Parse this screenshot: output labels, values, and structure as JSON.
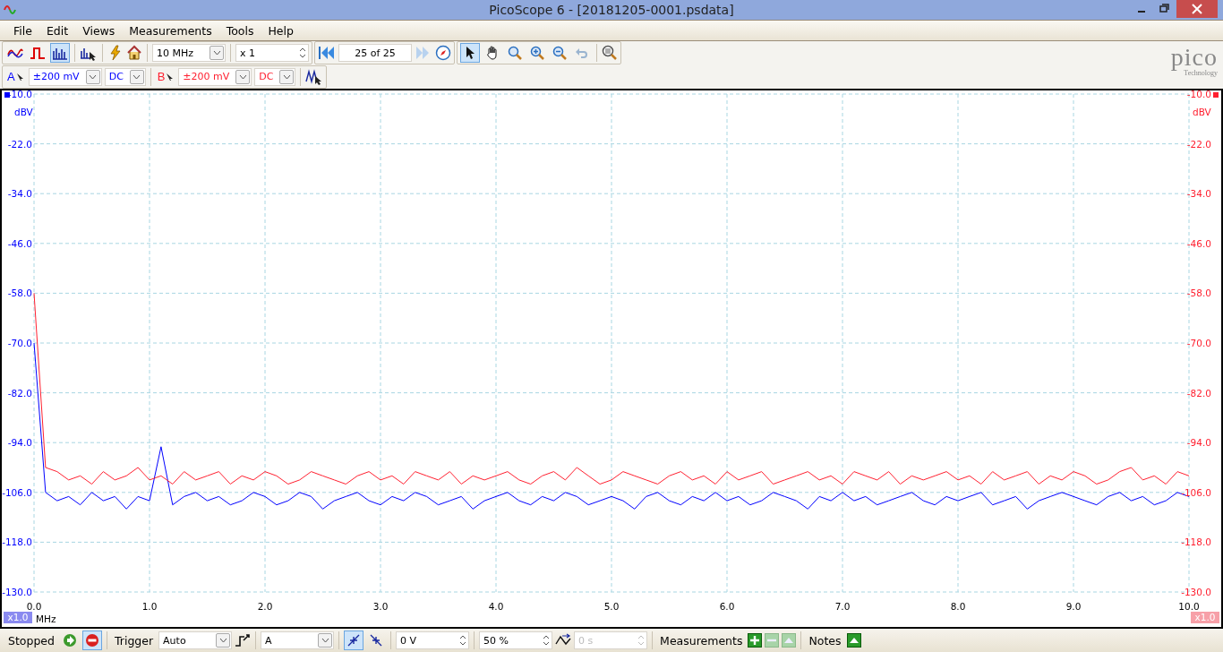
{
  "window": {
    "title": "PicoScope 6 - [20181205-0001.psdata]"
  },
  "menu": [
    "File",
    "Edit",
    "Views",
    "Measurements",
    "Tools",
    "Help"
  ],
  "toolbar": {
    "modes": [
      {
        "kind": "scope",
        "selected": false
      },
      {
        "kind": "persist",
        "selected": false
      },
      {
        "kind": "spectrum",
        "selected": true
      }
    ],
    "timebase": "10 MHz",
    "zoom": "x 1",
    "buffer": "25 of 25",
    "tools": [
      {
        "kind": "pointer",
        "selected": true
      },
      {
        "kind": "hand",
        "selected": false
      },
      {
        "kind": "zoom",
        "selected": false
      },
      {
        "kind": "zoom-in",
        "selected": false
      },
      {
        "kind": "zoom-out",
        "selected": false
      },
      {
        "kind": "undo",
        "selected": false
      }
    ]
  },
  "channels": [
    {
      "name": "A",
      "range": "±200 mV",
      "coupling": "DC",
      "color": "#0000ff"
    },
    {
      "name": "B",
      "range": "±200 mV",
      "coupling": "DC",
      "color": "#ff2030"
    }
  ],
  "logo": {
    "name": "pico",
    "tagline": "Technology"
  },
  "plot": {
    "right_ylabel": "dBV",
    "right_yticks": [
      "-10.0",
      "-22.0",
      "-34.0",
      "-46.0",
      "-58.0",
      "-70.0",
      "-82.0",
      "-94.0",
      "-106.0",
      "-118.0",
      "-130.0"
    ],
    "scale_left": "x1.0",
    "scale_right": "x1.0",
    "chart_data": {
      "type": "line",
      "grid": true,
      "xlabel": "MHz",
      "ylabel": "dBV",
      "xlim": [
        0,
        10
      ],
      "ylim": [
        -130,
        -10
      ],
      "xticks": [
        {
          "value": 0,
          "label": "0.0"
        },
        {
          "value": 1,
          "label": "1.0"
        },
        {
          "value": 2,
          "label": "2.0"
        },
        {
          "value": 3,
          "label": "3.0"
        },
        {
          "value": 4,
          "label": "4.0"
        },
        {
          "value": 5,
          "label": "5.0"
        },
        {
          "value": 6,
          "label": "6.0"
        },
        {
          "value": 7,
          "label": "7.0"
        },
        {
          "value": 8,
          "label": "8.0"
        },
        {
          "value": 9,
          "label": "9.0"
        },
        {
          "value": 10,
          "label": "10.0"
        }
      ],
      "yticks": [
        {
          "value": -10,
          "label": "-10.0"
        },
        {
          "value": -22,
          "label": "-22.0"
        },
        {
          "value": -34,
          "label": "-34.0"
        },
        {
          "value": -46,
          "label": "-46.0"
        },
        {
          "value": -58,
          "label": "-58.0"
        },
        {
          "value": -70,
          "label": "-70.0"
        },
        {
          "value": -82,
          "label": "-82.0"
        },
        {
          "value": -94,
          "label": "-94.0"
        },
        {
          "value": -106,
          "label": "-106.0"
        },
        {
          "value": -118,
          "label": "-118.0"
        },
        {
          "value": -130,
          "label": "-130.0"
        }
      ],
      "x": [
        0,
        0.1,
        0.2,
        0.3,
        0.4,
        0.5,
        0.6,
        0.7,
        0.8,
        0.9,
        1,
        1.1,
        1.2,
        1.3,
        1.4,
        1.5,
        1.6,
        1.7,
        1.8,
        1.9,
        2,
        2.1,
        2.2,
        2.3,
        2.4,
        2.5,
        2.6,
        2.7,
        2.8,
        2.9,
        3,
        3.1,
        3.2,
        3.3,
        3.4,
        3.5,
        3.6,
        3.7,
        3.8,
        3.9,
        4,
        4.1,
        4.2,
        4.3,
        4.4,
        4.5,
        4.6,
        4.7,
        4.8,
        4.9,
        5,
        5.1,
        5.2,
        5.3,
        5.4,
        5.5,
        5.6,
        5.7,
        5.8,
        5.9,
        6,
        6.1,
        6.2,
        6.3,
        6.4,
        6.5,
        6.6,
        6.7,
        6.8,
        6.9,
        7,
        7.1,
        7.2,
        7.3,
        7.4,
        7.5,
        7.6,
        7.7,
        7.8,
        7.9,
        8,
        8.1,
        8.2,
        8.3,
        8.4,
        8.5,
        8.6,
        8.7,
        8.8,
        8.9,
        9,
        9.1,
        9.2,
        9.3,
        9.4,
        9.5,
        9.6,
        9.7,
        9.8,
        9.9,
        10
      ],
      "series": [
        {
          "color": "#0000ff",
          "values": [
            -70,
            -106,
            -108,
            -107,
            -109,
            -106,
            -108,
            -107,
            -110,
            -107,
            -108,
            -95,
            -109,
            -107,
            -106,
            -108,
            -107,
            -109,
            -108,
            -106,
            -107,
            -109,
            -108,
            -106,
            -107,
            -110,
            -108,
            -107,
            -106,
            -108,
            -109,
            -107,
            -108,
            -106,
            -107,
            -109,
            -108,
            -107,
            -110,
            -108,
            -107,
            -106,
            -108,
            -109,
            -107,
            -108,
            -106,
            -107,
            -109,
            -108,
            -107,
            -108,
            -110,
            -107,
            -106,
            -108,
            -109,
            -107,
            -108,
            -106,
            -108,
            -107,
            -109,
            -108,
            -106,
            -107,
            -108,
            -110,
            -107,
            -108,
            -106,
            -108,
            -107,
            -109,
            -108,
            -107,
            -106,
            -108,
            -109,
            -107,
            -108,
            -107,
            -106,
            -109,
            -108,
            -107,
            -110,
            -108,
            -107,
            -106,
            -107,
            -108,
            -109,
            -107,
            -106,
            -108,
            -107,
            -109,
            -108,
            -106,
            -107
          ]
        },
        {
          "color": "#ff2030",
          "values": [
            -58,
            -100,
            -101,
            -103,
            -102,
            -104,
            -101,
            -103,
            -102,
            -100,
            -103,
            -102,
            -104,
            -101,
            -103,
            -102,
            -101,
            -104,
            -102,
            -103,
            -101,
            -102,
            -104,
            -103,
            -101,
            -102,
            -103,
            -104,
            -102,
            -101,
            -103,
            -102,
            -104,
            -101,
            -102,
            -103,
            -101,
            -104,
            -102,
            -103,
            -102,
            -101,
            -103,
            -104,
            -102,
            -101,
            -103,
            -100,
            -102,
            -104,
            -103,
            -101,
            -102,
            -103,
            -104,
            -102,
            -101,
            -103,
            -102,
            -104,
            -101,
            -103,
            -102,
            -101,
            -104,
            -103,
            -102,
            -101,
            -103,
            -102,
            -104,
            -101,
            -102,
            -103,
            -101,
            -104,
            -102,
            -103,
            -102,
            -101,
            -103,
            -102,
            -104,
            -101,
            -103,
            -102,
            -101,
            -104,
            -102,
            -103,
            -101,
            -102,
            -104,
            -103,
            -101,
            -100,
            -103,
            -102,
            -104,
            -101,
            -102
          ]
        }
      ]
    }
  },
  "statusbar": {
    "state": "Stopped",
    "running": false,
    "trigger_label": "Trigger",
    "trigger_mode": "Auto",
    "trigger_source": "A",
    "edge_rising": true,
    "threshold": "0 V",
    "pretrigger": "50 %",
    "delay": "0 s",
    "measurements_label": "Measurements",
    "notes_label": "Notes"
  }
}
